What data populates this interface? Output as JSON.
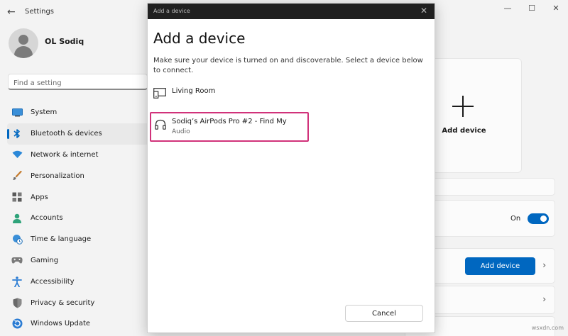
{
  "window": {
    "title": "Settings",
    "controls": [
      "—",
      "☐",
      "✕"
    ]
  },
  "profile": {
    "name": "OL Sodiq"
  },
  "search": {
    "placeholder": "Find a setting"
  },
  "sidebar": {
    "items": [
      {
        "label": "System",
        "icon": "monitor-icon",
        "active": false
      },
      {
        "label": "Bluetooth & devices",
        "icon": "bluetooth-icon",
        "active": true
      },
      {
        "label": "Network & internet",
        "icon": "wifi-icon",
        "active": false
      },
      {
        "label": "Personalization",
        "icon": "brush-icon",
        "active": false
      },
      {
        "label": "Apps",
        "icon": "apps-icon",
        "active": false
      },
      {
        "label": "Accounts",
        "icon": "person-icon",
        "active": false
      },
      {
        "label": "Time & language",
        "icon": "globe-clock-icon",
        "active": false
      },
      {
        "label": "Gaming",
        "icon": "gamepad-icon",
        "active": false
      },
      {
        "label": "Accessibility",
        "icon": "accessibility-icon",
        "active": false
      },
      {
        "label": "Privacy & security",
        "icon": "shield-icon",
        "active": false
      },
      {
        "label": "Windows Update",
        "icon": "update-icon",
        "active": false
      }
    ]
  },
  "content": {
    "add_device_card_label": "Add device",
    "bluetooth_toggle_label": "On",
    "add_device_button_label": "Add device"
  },
  "dialog": {
    "titlebar": "Add a device",
    "heading": "Add a device",
    "description": "Make sure your device is turned on and discoverable. Select a device below to connect.",
    "devices": [
      {
        "name": "Living Room",
        "type": "",
        "icon": "display-icon"
      },
      {
        "name": "Sodiq’s AirPods Pro #2 - Find My",
        "type": "Audio",
        "icon": "headphones-icon"
      }
    ],
    "cancel_label": "Cancel"
  },
  "watermark": "wsxdn.com",
  "colors": {
    "accent": "#0067c0",
    "highlight": "#d1327a",
    "dialog_titlebar": "#202020"
  }
}
